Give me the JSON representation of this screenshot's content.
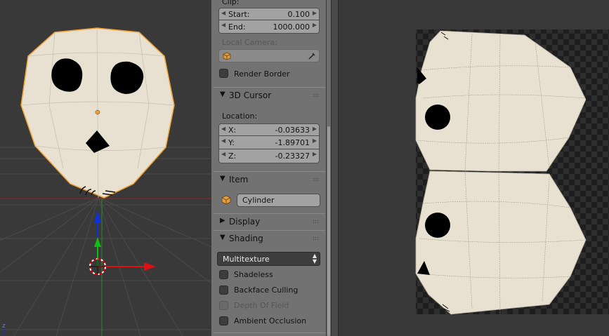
{
  "properties": {
    "clip": {
      "label": "Clip:",
      "start_label": "Start:",
      "start_value": "0.100",
      "end_label": "End:",
      "end_value": "1000.000"
    },
    "local_camera_label": "Local Camera:",
    "render_border_label": "Render Border",
    "cursor_panel": {
      "title": "3D Cursor",
      "location_label": "Location:",
      "x_label": "X:",
      "x_value": "-0.03633",
      "y_label": "Y:",
      "y_value": "-1.89701",
      "z_label": "Z:",
      "z_value": "-0.23327"
    },
    "item_panel": {
      "title": "Item",
      "object_name": "Cylinder"
    },
    "display_panel": {
      "title": "Display"
    },
    "shading_panel": {
      "title": "Shading",
      "mode": "Multitexture",
      "shadeless_label": "Shadeless",
      "backface_label": "Backface Culling",
      "depth_label": "Depth Of Field",
      "ao_label": "Ambient Occlusion"
    }
  },
  "viewport": {
    "axis_label": "z",
    "x_axis_color": "#e01010",
    "y_axis_color": "#10c010",
    "z_axis_color": "#1030e0",
    "mesh_color": "#e8e1d2",
    "selection_color": "#f0a030"
  }
}
